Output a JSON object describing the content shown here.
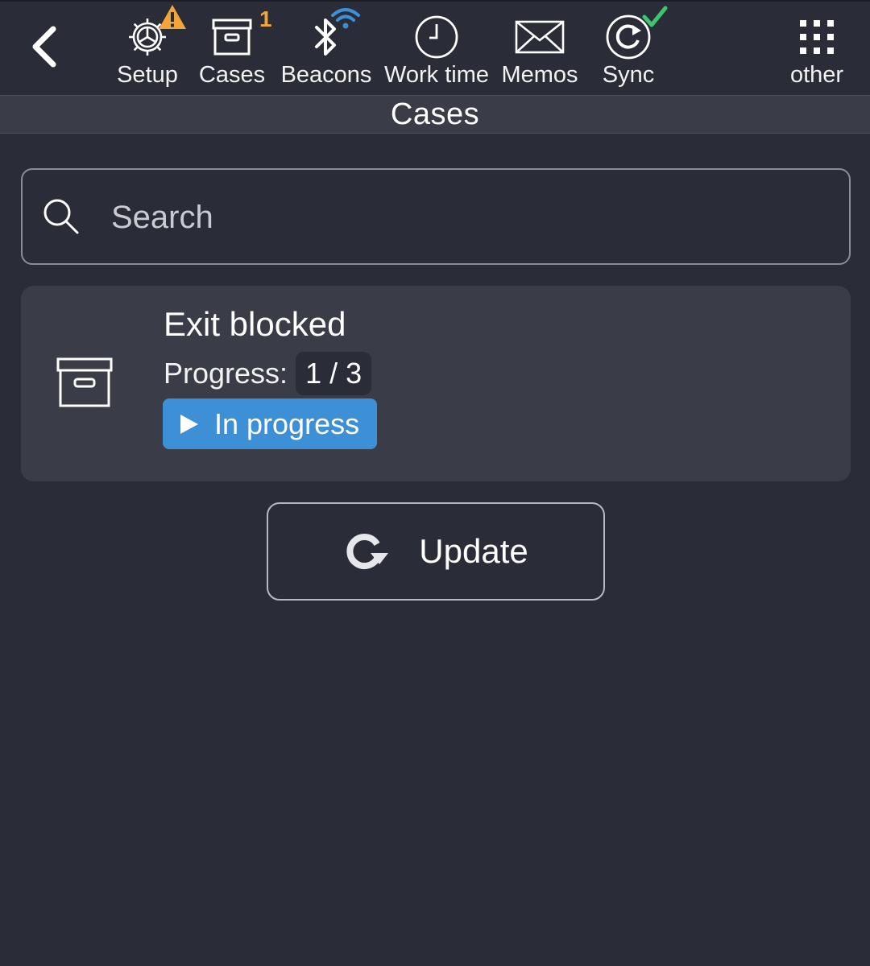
{
  "topbar": {
    "nav": [
      {
        "label": "Setup",
        "icon": "gear-icon"
      },
      {
        "label": "Cases",
        "icon": "archive-box-icon",
        "badge": "1"
      },
      {
        "label": "Beacons",
        "icon": "bluetooth-icon"
      },
      {
        "label": "Work time",
        "icon": "clock-icon"
      },
      {
        "label": "Memos",
        "icon": "envelope-icon"
      },
      {
        "label": "Sync",
        "icon": "sync-icon"
      },
      {
        "label": "other",
        "icon": "grid-icon"
      }
    ]
  },
  "page": {
    "title": "Cases"
  },
  "search": {
    "placeholder": "Search",
    "value": ""
  },
  "cases": [
    {
      "title": "Exit blocked",
      "progress_label": "Progress:",
      "progress_value": "1 / 3",
      "status": "In progress"
    }
  ],
  "actions": {
    "update_label": "Update"
  },
  "colors": {
    "background": "#2a2d37",
    "card": "#3a3d47",
    "status_blue": "#3d8fd6",
    "warning_orange": "#f0a63a",
    "sync_green": "#3ec46d",
    "wifi_blue": "#3d8fd6"
  }
}
